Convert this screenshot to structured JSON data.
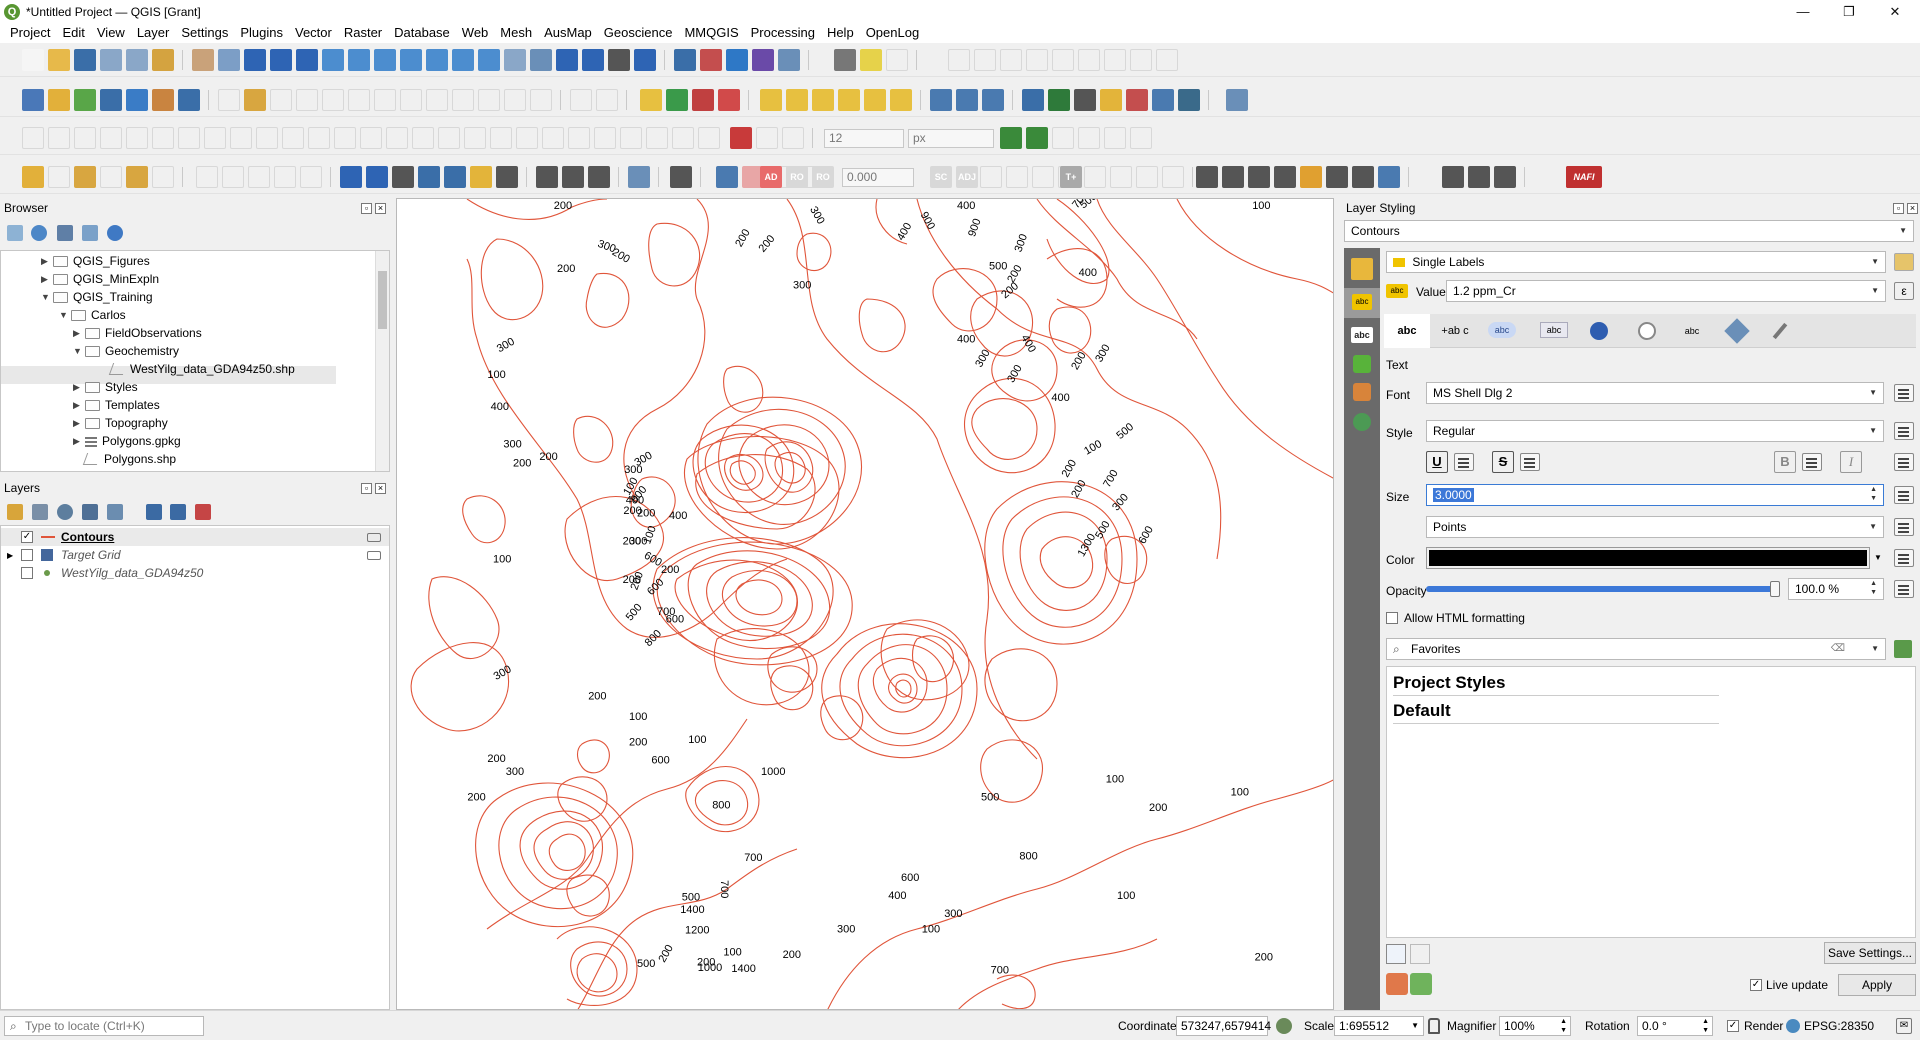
{
  "window": {
    "title": "*Untitled Project — QGIS [Grant]",
    "controls": [
      "—",
      "❐",
      "✕"
    ]
  },
  "menu": [
    "Project",
    "Edit",
    "View",
    "Layer",
    "Settings",
    "Plugins",
    "Vector",
    "Raster",
    "Database",
    "Web",
    "Mesh",
    "AusMap",
    "Geoscience",
    "MMQGIS",
    "Processing",
    "Help",
    "OpenLog"
  ],
  "toolbar": {
    "font_size_value": "12",
    "font_unit": "px",
    "label_offset_value": "0.000",
    "label_badges": [
      "AD",
      "RO",
      "RO",
      "SC",
      "ADJ",
      "T+",
      "NAFI"
    ]
  },
  "browser": {
    "title": "Browser",
    "items": [
      {
        "label": "QGIS_Figures",
        "arrow": "▶",
        "kind": "folder"
      },
      {
        "label": "QGIS_MinExpln",
        "arrow": "▶",
        "kind": "folder"
      },
      {
        "label": "QGIS_Training",
        "arrow": "▼",
        "kind": "folder"
      },
      {
        "label": "Carlos",
        "arrow": "▼",
        "kind": "folder"
      },
      {
        "label": "FieldObservations",
        "arrow": "▶",
        "kind": "folder"
      },
      {
        "label": "Geochemistry",
        "arrow": "▼",
        "kind": "folder"
      },
      {
        "label": "WestYilg_data_GDA94z50.shp",
        "arrow": "",
        "kind": "shp"
      },
      {
        "label": "Styles",
        "arrow": "▶",
        "kind": "folder"
      },
      {
        "label": "Templates",
        "arrow": "▶",
        "kind": "folder"
      },
      {
        "label": "Topography",
        "arrow": "▶",
        "kind": "folder"
      },
      {
        "label": "Polygons.gpkg",
        "arrow": "▶",
        "kind": "gpkg"
      },
      {
        "label": "Polygons.shp",
        "arrow": "",
        "kind": "shp"
      }
    ]
  },
  "layers": {
    "title": "Layers",
    "items": [
      {
        "name": "Contours",
        "checked": true,
        "check": "✓"
      },
      {
        "name": "Target Grid",
        "checked": false,
        "check": ""
      },
      {
        "name": "WestYilg_data_GDA94z50",
        "checked": false,
        "check": ""
      }
    ]
  },
  "map": {
    "contour_color": "#e0553a",
    "contour_labels": [
      {
        "t": "200"
      },
      {
        "t": "100"
      },
      {
        "t": "200"
      },
      {
        "t": "300"
      },
      {
        "t": "200"
      },
      {
        "t": "200"
      },
      {
        "t": "900"
      },
      {
        "t": "400"
      },
      {
        "t": "300"
      },
      {
        "t": "200"
      },
      {
        "t": "300"
      },
      {
        "t": "400"
      },
      {
        "t": "500"
      },
      {
        "t": "900"
      },
      {
        "t": "700"
      },
      {
        "t": "500"
      },
      {
        "t": "400"
      },
      {
        "t": "200"
      },
      {
        "t": "300"
      },
      {
        "t": "200"
      },
      {
        "t": "400"
      },
      {
        "t": "300"
      },
      {
        "t": "400"
      },
      {
        "t": "300"
      },
      {
        "t": "200"
      },
      {
        "t": "300"
      },
      {
        "t": "400"
      },
      {
        "t": "200"
      },
      {
        "t": "100"
      },
      {
        "t": "500"
      },
      {
        "t": "300"
      },
      {
        "t": "700"
      },
      {
        "t": "600"
      },
      {
        "t": "1300"
      },
      {
        "t": "200"
      },
      {
        "t": "500"
      },
      {
        "t": "300"
      },
      {
        "t": "400"
      },
      {
        "t": "100"
      },
      {
        "t": "300"
      },
      {
        "t": "200"
      },
      {
        "t": "200"
      },
      {
        "t": "800"
      },
      {
        "t": "600"
      },
      {
        "t": "400"
      },
      {
        "t": "600"
      },
      {
        "t": "700"
      },
      {
        "t": "500"
      },
      {
        "t": "800"
      },
      {
        "t": "600"
      },
      {
        "t": "200"
      },
      {
        "t": "400"
      },
      {
        "t": "200"
      },
      {
        "t": "200"
      },
      {
        "t": "200"
      },
      {
        "t": "100"
      },
      {
        "t": "300"
      },
      {
        "t": "300"
      },
      {
        "t": "200"
      },
      {
        "t": "100"
      },
      {
        "t": "300"
      },
      {
        "t": "200"
      },
      {
        "t": "200"
      },
      {
        "t": "200"
      },
      {
        "t": "300"
      },
      {
        "t": "300"
      },
      {
        "t": "100"
      },
      {
        "t": "200"
      },
      {
        "t": "200"
      },
      {
        "t": "100"
      },
      {
        "t": "600"
      },
      {
        "t": "700"
      },
      {
        "t": "800"
      },
      {
        "t": "1000"
      },
      {
        "t": "1400"
      },
      {
        "t": "1200"
      },
      {
        "t": "500"
      },
      {
        "t": "500"
      },
      {
        "t": "200"
      },
      {
        "t": "200"
      },
      {
        "t": "100"
      },
      {
        "t": "700"
      },
      {
        "t": "1000"
      },
      {
        "t": "1400"
      },
      {
        "t": "200"
      },
      {
        "t": "300"
      },
      {
        "t": "400"
      },
      {
        "t": "100"
      },
      {
        "t": "300"
      },
      {
        "t": "600"
      },
      {
        "t": "700"
      },
      {
        "t": "500"
      },
      {
        "t": "800"
      },
      {
        "t": "100"
      },
      {
        "t": "100"
      },
      {
        "t": "200"
      },
      {
        "t": "100"
      },
      {
        "t": "200"
      },
      {
        "t": "100"
      }
    ]
  },
  "styling": {
    "title": "Layer Styling",
    "layer": "Contours",
    "mode": "Single Labels",
    "value_label": "Value",
    "value": "1.2  ppm_Cr",
    "section": "Text",
    "font_label": "Font",
    "font": "MS Shell Dlg 2",
    "style_label": "Style",
    "style": "Regular",
    "size_label": "Size",
    "size": "3.0000",
    "unit": "Points",
    "color_label": "Color",
    "text_color": "#000000",
    "opacity_label": "Opacity",
    "opacity": "100.0 %",
    "opacity_fraction": 1.0,
    "html_formatting": "Allow HTML formatting",
    "search_placeholder": "Favorites",
    "style_groups": [
      "Project Styles",
      "Default"
    ],
    "save_button": "Save Settings...",
    "live_update": "Live update",
    "apply": "Apply",
    "tabs": [
      "abc",
      "+ab c",
      "abc",
      "abc",
      "",
      "",
      "abc",
      "",
      ""
    ],
    "format_buttons": [
      "U",
      "S",
      "B",
      "I"
    ]
  },
  "status": {
    "locate_placeholder": "Type to locate (Ctrl+K)",
    "coordinate_label": "Coordinate",
    "coordinate": "573247,6579414",
    "scale_label": "Scale",
    "scale": "1:695512",
    "magnifier_label": "Magnifier",
    "magnifier": "100%",
    "rotation_label": "Rotation",
    "rotation": "0.0 °",
    "render_label": "Render",
    "crs": "EPSG:28350"
  }
}
